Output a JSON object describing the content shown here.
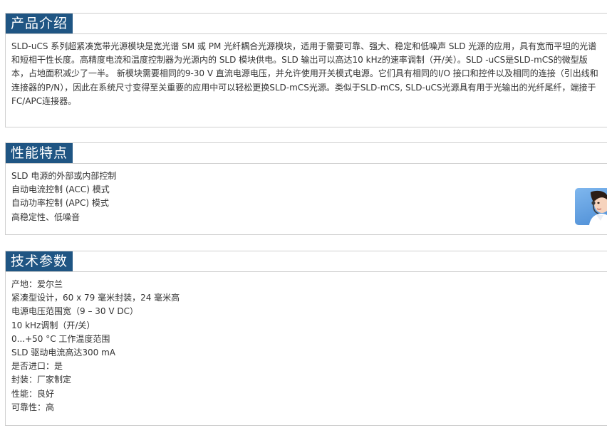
{
  "intro": {
    "title": "产品介绍",
    "paragraph": "SLD-uCS 系列超紧凑宽带光源模块是宽光谱 SM 或 PM 光纤耦合光源模块，适用于需要可靠、强大、稳定和低噪声 SLD 光源的应用，具有宽而平坦的光谱和短相干性长度。高精度电流和温度控制器为光源内的 SLD 模块供电。SLD 输出可以高达10 kHz的速率调制（开/关）。SLD -uCS是SLD-mCS的微型版本，占地面积减少了一半。 新模块需要相同的9-30 V 直流电源电压，并允许使用开关模式电源。它们具有相同的I/O 接口和控件以及相同的连接（引出线和连接器的P/N），因此在系统尺寸变得至关重要的应用中可以轻松更换SLD-mCS光源。类似于SLD-mCS, SLD-uCS光源具有用于光输出的光纤尾纤，端接于FC/APC连接器。"
  },
  "features": {
    "title": "性能特点",
    "items": [
      "SLD 电源的外部或内部控制",
      "自动电流控制 (ACC) 模式",
      "自动功率控制 (APC) 模式",
      "高稳定性、低噪音"
    ]
  },
  "specs": {
    "title": "技术参数",
    "items": [
      "产地：爱尔兰",
      "紧凑型设计，60 x 79 毫米封装，24 毫米高",
      "电源电压范围宽（9 – 30 V DC）",
      "10 kHz调制（开/关）",
      "0...+50 °C 工作温度范围",
      "SLD 驱动电流高达300 mA",
      "是否进口：是",
      "封装：厂家制定",
      "性能：良好",
      "可靠性：高"
    ]
  },
  "widget": {
    "icon": "customer-service-icon",
    "colors": {
      "accent": "#1f5583",
      "widget_bg": "#5b9be0"
    }
  }
}
